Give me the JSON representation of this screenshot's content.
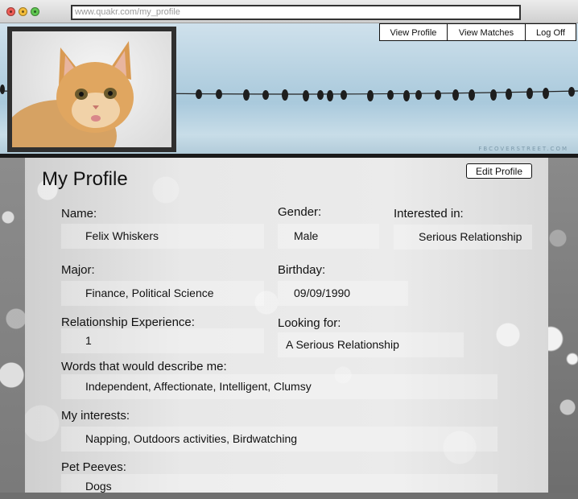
{
  "browser": {
    "url": "www.quakr.com/my_profile"
  },
  "banner": {
    "watermark": "FBCOVERSTREET.COM"
  },
  "nav": {
    "view_profile": "View Profile",
    "view_matches": "View Matches",
    "log_off": "Log Off"
  },
  "page": {
    "title": "My Profile",
    "edit_button": "Edit Profile"
  },
  "profile": {
    "name": {
      "label": "Name:",
      "value": "Felix Whiskers"
    },
    "gender": {
      "label": "Gender:",
      "value": "Male"
    },
    "interested_in": {
      "label": "Interested in:",
      "value": "Serious Relationship"
    },
    "major": {
      "label": "Major:",
      "value": "Finance, Political Science"
    },
    "birthday": {
      "label": "Birthday:",
      "value": "09/09/1990"
    },
    "relationship_experience": {
      "label": "Relationship Experience:",
      "value": "1"
    },
    "looking_for": {
      "label": "Looking for:",
      "value": "A Serious Relationship"
    },
    "words": {
      "label": "Words that would describe me:",
      "value": "Independent, Affectionate, Intelligent, Clumsy"
    },
    "interests": {
      "label": "My interests:",
      "value": "Napping, Outdoors activities, Birdwatching"
    },
    "pet_peeves": {
      "label": "Pet Peeves:",
      "value": "Dogs"
    }
  },
  "colors": {
    "sky": "#b9d3e2",
    "frame": "#2f2f2f",
    "panel": "#e8e8e8"
  }
}
